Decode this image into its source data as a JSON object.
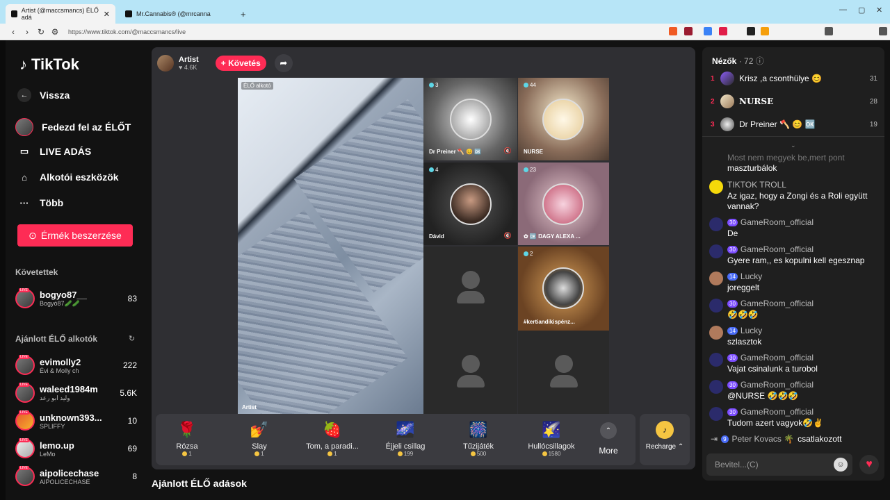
{
  "browser": {
    "tabs": [
      {
        "title": "Artist (@maccsmancs) ÉLŐ adá"
      },
      {
        "title": "Mr.Cannabis® (@mrcanna"
      }
    ],
    "new_tab": "+",
    "url": "https://www.tiktok.com/@maccsmancs/live"
  },
  "sidebar": {
    "logo": "TikTok",
    "back": "Vissza",
    "nav": [
      {
        "label": "Fedezd fel az ÉLŐT",
        "icon": "avatar-icon"
      },
      {
        "label": "LIVE ADÁS",
        "icon": "camera-icon"
      },
      {
        "label": "Alkotói eszközök",
        "icon": "creator-tools-icon"
      },
      {
        "label": "Több",
        "icon": "more-dots-icon"
      }
    ],
    "coins_button": "Érmék beszerzése",
    "following_heading": "Követettek",
    "following": [
      {
        "name": "bogyo87__",
        "sub": "Bogyó87🥒🥒",
        "count": "83"
      }
    ],
    "recommended_heading": "Ajánlott ÉLŐ alkotók",
    "recommended": [
      {
        "name": "evimolly2",
        "sub": "Évi & Molly ch",
        "count": "222"
      },
      {
        "name": "waleed1984m",
        "sub": "وليد ابو رعد",
        "count": "5.6K"
      },
      {
        "name": "unknown393...",
        "sub": "SPLIFFY",
        "count": "10"
      },
      {
        "name": "lemo.up",
        "sub": "LeMo",
        "count": "69"
      },
      {
        "name": "aipolicechase",
        "sub": "AIPOLICECHASE",
        "count": "8"
      }
    ],
    "live_tag": "LIVE"
  },
  "stream": {
    "creator_name": "Artist",
    "likes": "4.6K",
    "follow_label": "+ Követés",
    "main_badge": "ÉLŐ alkotó",
    "main_name": "Artist",
    "guests": [
      {
        "count": "3",
        "name": "Dr Preiner 🪓 😊 🆗",
        "muted": true
      },
      {
        "count": "44",
        "name": "NURSE",
        "muted": false
      },
      {
        "count": "4",
        "name": "Dávid",
        "muted": true
      },
      {
        "count": "23",
        "name": "✿ 🆗 ŊAGY ALEXA ...",
        "muted": false
      },
      {
        "count": "",
        "name": "",
        "muted": false
      },
      {
        "count": "2",
        "name": "#kertiandikispénz...",
        "muted": false
      },
      {
        "count": "",
        "name": "",
        "muted": false
      },
      {
        "count": "",
        "name": "",
        "muted": false
      }
    ]
  },
  "gifts": [
    {
      "name": "Rózsa",
      "price": "1",
      "icon": "🌹"
    },
    {
      "name": "Slay",
      "price": "1",
      "icon": "💅"
    },
    {
      "name": "Tom, a paradi...",
      "price": "1",
      "icon": "🍓"
    },
    {
      "name": "Éjjeli csillag",
      "price": "199",
      "icon": "🌌"
    },
    {
      "name": "Tűzijáték",
      "price": "500",
      "icon": "🎆"
    },
    {
      "name": "Hullócsillagok",
      "price": "1580",
      "icon": "🌠"
    }
  ],
  "more_label": "More",
  "recharge_label": "Recharge ⌃",
  "recommended_streams_heading": "Ajánlott ÉLŐ adások",
  "chat": {
    "viewers_label": "Nézők",
    "viewers_count": "· 72",
    "top_viewers": [
      {
        "rank": "1",
        "name": "Krisz ,a csonthülye 😊",
        "score": "31"
      },
      {
        "rank": "2",
        "name": "NURSE",
        "score": "28"
      },
      {
        "rank": "3",
        "name": "Dr Preiner 🪓 😊 🆗",
        "score": "19"
      }
    ],
    "messages": [
      {
        "user": "Most nem megyek be,mert pont",
        "level": "",
        "text": "maszturbálok"
      },
      {
        "user": "TIKTOK TROLL",
        "level": "",
        "text": "Az igaz, hogy a Zongi és a Roli együtt vannak?"
      },
      {
        "user": "GameRoom_official",
        "level": "30",
        "text": "De"
      },
      {
        "user": "GameRoom_official",
        "level": "30",
        "text": "Gyere ram,, es kopulni kell egesznap"
      },
      {
        "user": "Lucky",
        "level": "14",
        "text": "joreggelt"
      },
      {
        "user": "GameRoom_official",
        "level": "30",
        "text": "🤣🤣🤣"
      },
      {
        "user": "Lucky",
        "level": "14",
        "text": "szlasztok"
      },
      {
        "user": "GameRoom_official",
        "level": "30",
        "text": "Vajat csinalunk a turobol"
      },
      {
        "user": "GameRoom_official",
        "level": "30",
        "text": "@NURSE 🤣🤣🤣"
      },
      {
        "user": "GameRoom_official",
        "level": "30",
        "text": "Tudom azert vagyok🤣✌"
      }
    ],
    "join": {
      "level": "9",
      "user": "Peter Kovacs 🌴",
      "text": "csatlakozott"
    },
    "input_placeholder": "Bevitel...(C)"
  }
}
